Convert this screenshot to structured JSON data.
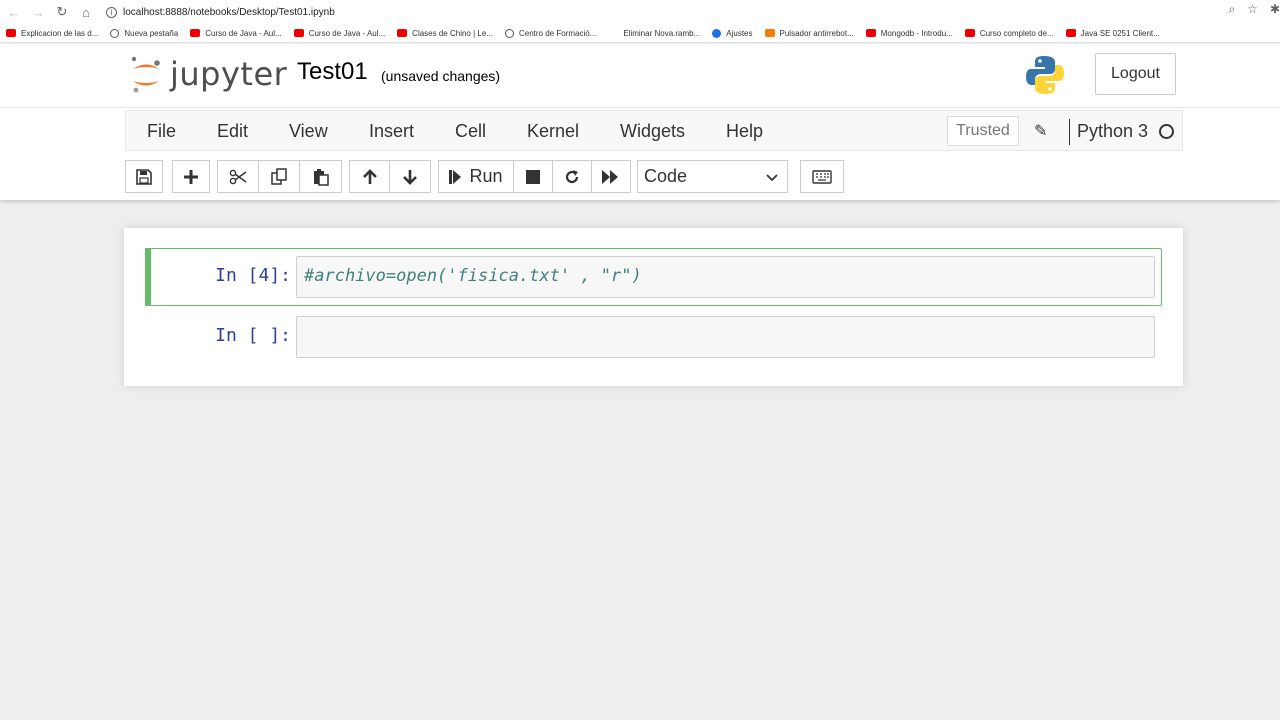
{
  "browser": {
    "url": "localhost:8888/notebooks/Desktop/Test01.ipynb",
    "bookmarks": [
      {
        "label": "Explicacion de las d...",
        "icon": "youtube-icon"
      },
      {
        "label": "Nueva pestaña",
        "icon": "globe-icon"
      },
      {
        "label": "Curso de Java - Aul...",
        "icon": "youtube-icon"
      },
      {
        "label": "Curso de Java - Aul...",
        "icon": "youtube-icon"
      },
      {
        "label": "Clases de Chino | Le...",
        "icon": "youtube-icon"
      },
      {
        "label": "Centro de Formació...",
        "icon": "globe-icon"
      },
      {
        "label": "Eliminar Nova.ramb...",
        "icon": "bookmark-icon"
      },
      {
        "label": "Ajustes",
        "icon": "gear-icon"
      },
      {
        "label": "Pulsador antirrebot...",
        "icon": "blogger-icon"
      },
      {
        "label": "Mongodb - Introdu...",
        "icon": "youtube-icon"
      },
      {
        "label": "Curso completo de...",
        "icon": "youtube-icon"
      },
      {
        "label": "Java SE 0251 Client...",
        "icon": "youtube-icon"
      }
    ]
  },
  "header": {
    "logo_text": "jupyter",
    "notebook_name": "Test01",
    "save_status": "(unsaved changes)",
    "logout_label": "Logout"
  },
  "menu": {
    "items": [
      "File",
      "Edit",
      "View",
      "Insert",
      "Cell",
      "Kernel",
      "Widgets",
      "Help"
    ],
    "trusted_label": "Trusted",
    "kernel_name": "Python 3"
  },
  "toolbar": {
    "run_label": "Run",
    "cell_type": "Code",
    "cell_type_options": [
      "Code"
    ]
  },
  "cells": [
    {
      "prompt": "In [4]:",
      "code": "#archivo=open('fisica.txt' , \"r\")",
      "selected": true
    },
    {
      "prompt": "In [ ]:",
      "code": "",
      "selected": false
    }
  ],
  "colors": {
    "selected_border": "#66bb6a",
    "prompt_color": "#303f9f",
    "comment_color": "#408080",
    "jupyter_orange": "#f37726"
  }
}
